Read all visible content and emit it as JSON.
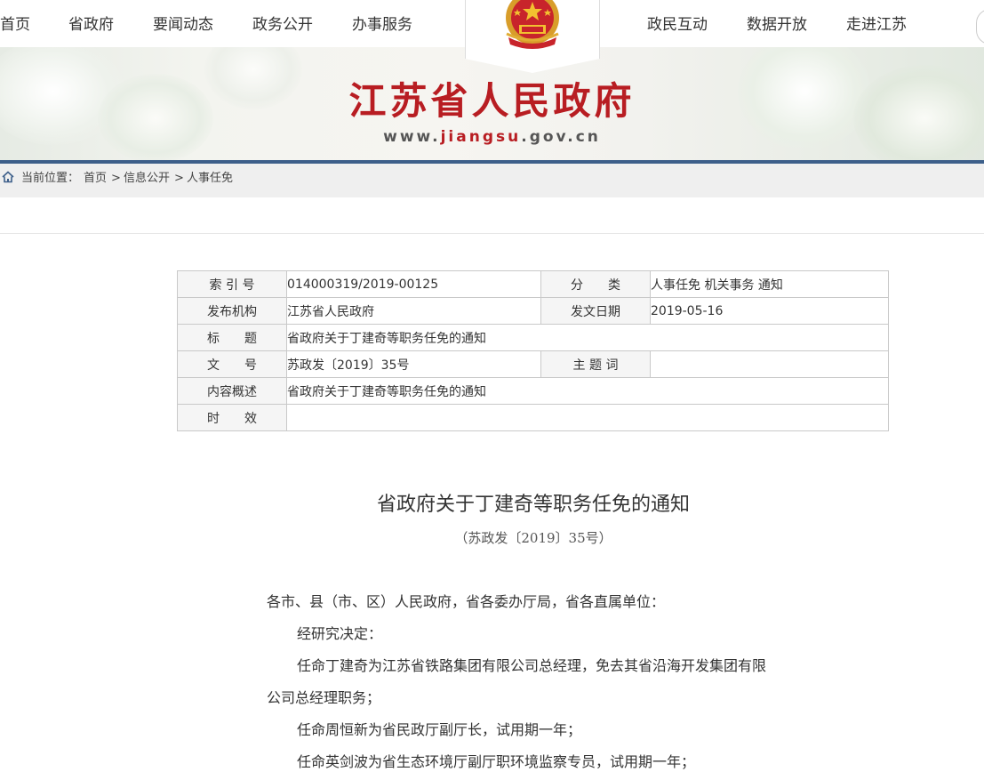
{
  "nav": {
    "left": [
      "首页",
      "省政府",
      "要闻动态",
      "政务公开",
      "办事服务"
    ],
    "right": [
      "政民互动",
      "数据开放",
      "走进江苏"
    ]
  },
  "banner": {
    "title": "江苏省人民政府",
    "url_prefix": "www.",
    "url_highlight": "jiangsu",
    "url_suffix": ".gov.cn"
  },
  "breadcrumb": {
    "label": "当前位置：",
    "items": [
      "首页",
      ">",
      "信息公开",
      ">",
      "人事任免"
    ]
  },
  "meta": {
    "index_label": "索 引 号",
    "index_value": "014000319/2019-00125",
    "category_label": "分　　类",
    "category_value": "人事任免 机关事务 通知",
    "org_label": "发布机构",
    "org_value": "江苏省人民政府",
    "date_label": "发文日期",
    "date_value": "2019-05-16",
    "title_label": "标　　题",
    "title_value": "省政府关于丁建奇等职务任免的通知",
    "docno_label": "文　　号",
    "docno_value": "苏政发〔2019〕35号",
    "keyword_label": "主 题 词",
    "keyword_value": "",
    "summary_label": "内容概述",
    "summary_value": "省政府关于丁建奇等职务任免的通知",
    "validity_label": "时　　效",
    "validity_value": ""
  },
  "document": {
    "title": "省政府关于丁建奇等职务任免的通知",
    "number": "（苏政发〔2019〕35号）",
    "paragraphs": [
      "各市、县（市、区）人民政府，省各委办厅局，省各直属单位：",
      "经研究决定：",
      "任命丁建奇为江苏省铁路集团有限公司总经理，免去其省沿海开发集团有限",
      "公司总经理职务；",
      "任命周恒新为省民政厅副厅长，试用期一年；",
      "任命英剑波为省生态环境厅副厅职环境监察专员，试用期一年；"
    ]
  },
  "colors": {
    "title_red": "#b81d22",
    "nav_blue_line": "#3d5f8a"
  }
}
